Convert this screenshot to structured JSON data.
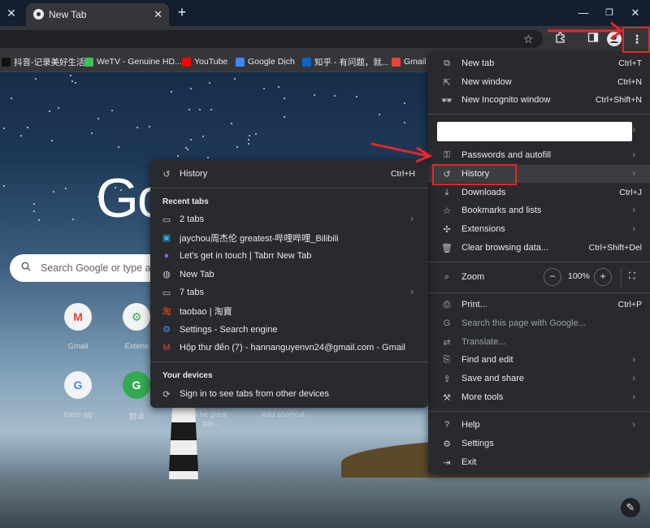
{
  "tabs": [
    {
      "title": "New Tab"
    }
  ],
  "bookmarks": [
    {
      "label": "抖音-记录美好生活",
      "color": "#111111"
    },
    {
      "label": "WeTV - Genuine HD...",
      "color": "#3fbf5a"
    },
    {
      "label": "YouTube",
      "color": "#ff0000"
    },
    {
      "label": "Google Dịch",
      "color": "#4285f4"
    },
    {
      "label": "知乎 - 有问题，就...",
      "color": "#0a66c2"
    },
    {
      "label": "Gmail",
      "color": "#ea4335"
    }
  ],
  "ntp": {
    "logo_text": "Go",
    "search_placeholder": "Search Google or type a U",
    "shortcuts": [
      {
        "label": "Gmail",
        "glyph": "M"
      },
      {
        "label": "Extens",
        "glyph": "⚙"
      },
      {
        "label": "trans qq",
        "glyph": "G"
      },
      {
        "label": "翻译",
        "glyph": "G"
      },
      {
        "label": "The great gat...",
        "glyph": ""
      },
      {
        "label": "Add shortcut",
        "glyph": "+"
      }
    ]
  },
  "main_menu": {
    "new_tab": {
      "label": "New tab",
      "shortcut": "Ctrl+T"
    },
    "new_window": {
      "label": "New window",
      "shortcut": "Ctrl+N"
    },
    "new_incognito": {
      "label": "New Incognito window",
      "shortcut": "Ctrl+Shift+N"
    },
    "passwords": {
      "label": "Passwords and autofill"
    },
    "history": {
      "label": "History"
    },
    "downloads": {
      "label": "Downloads",
      "shortcut": "Ctrl+J"
    },
    "bookmarks": {
      "label": "Bookmarks and lists"
    },
    "extensions": {
      "label": "Extensions"
    },
    "clear_data": {
      "label": "Clear browsing data...",
      "shortcut": "Ctrl+Shift+Del"
    },
    "zoom": {
      "label": "Zoom",
      "value": "100%",
      "minus": "−",
      "plus": "+"
    },
    "print": {
      "label": "Print...",
      "shortcut": "Ctrl+P"
    },
    "search_page": {
      "label": "Search this page with Google..."
    },
    "translate": {
      "label": "Translate..."
    },
    "find_edit": {
      "label": "Find and edit"
    },
    "save_share": {
      "label": "Save and share"
    },
    "more_tools": {
      "label": "More tools"
    },
    "help": {
      "label": "Help"
    },
    "settings": {
      "label": "Settings"
    },
    "exit": {
      "label": "Exit"
    }
  },
  "history_menu": {
    "history": {
      "label": "History",
      "shortcut": "Ctrl+H"
    },
    "recent_tabs_header": "Recent tabs",
    "recent": [
      {
        "label": "2 tabs",
        "icon": "window-icon",
        "color": "#c4c7c5",
        "chevron": true
      },
      {
        "label": "jaychou周杰伦 greatest-哔哩哔哩_Bilibili",
        "icon": "bilibili-icon",
        "color": "#23ade5"
      },
      {
        "label": "Let's get in touch | Tabrr New Tab",
        "icon": "tabrr-icon",
        "color": "#8a5cf6"
      },
      {
        "label": "New Tab",
        "icon": "globe-icon",
        "color": "#c4c7c5"
      },
      {
        "label": "7 tabs",
        "icon": "window-icon",
        "color": "#c4c7c5",
        "chevron": true
      },
      {
        "label": "taobao | 淘寶",
        "icon": "taobao-icon",
        "color": "#ff5000"
      },
      {
        "label": "Settings - Search engine",
        "icon": "settings-icon",
        "color": "#4c8df6"
      },
      {
        "label": "Hộp thư đến (7) - hannanguyenvn24@gmail.com - Gmail",
        "icon": "gmail-icon",
        "color": "#ea4335"
      }
    ],
    "devices_header": "Your devices",
    "sign_in": {
      "label": "Sign in to see tabs from other devices"
    }
  }
}
